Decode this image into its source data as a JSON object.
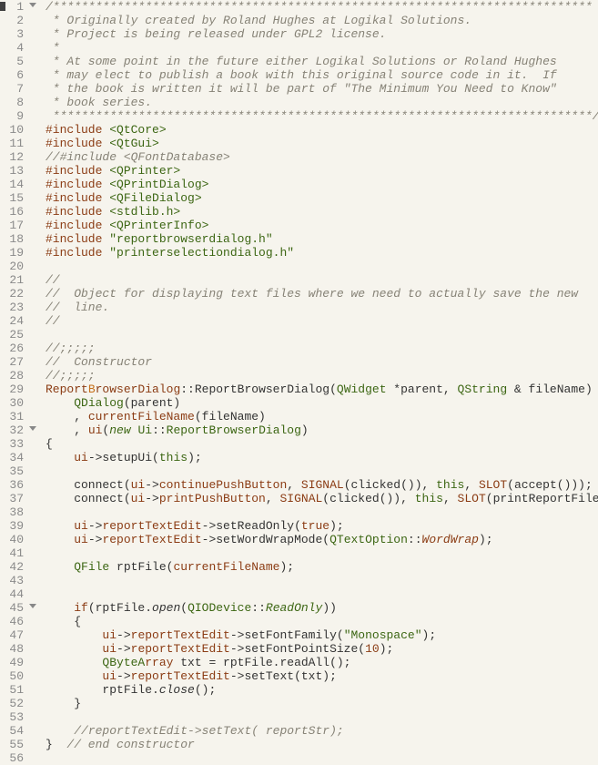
{
  "line_numbers": [
    "1",
    "2",
    "3",
    "4",
    "5",
    "6",
    "7",
    "8",
    "9",
    "10",
    "11",
    "12",
    "13",
    "14",
    "15",
    "16",
    "17",
    "18",
    "19",
    "20",
    "21",
    "22",
    "23",
    "24",
    "25",
    "26",
    "27",
    "28",
    "29",
    "30",
    "31",
    "32",
    "33",
    "34",
    "35",
    "36",
    "37",
    "38",
    "39",
    "40",
    "41",
    "42",
    "43",
    "44",
    "45",
    "46",
    "47",
    "48",
    "49",
    "50",
    "51",
    "52",
    "53",
    "54",
    "55",
    "56"
  ],
  "fold_lines": [
    1,
    32,
    45
  ],
  "marker_lines": [
    1
  ],
  "colors": {
    "background": "#f6f4ed",
    "gutter_text": "#8a8a8a",
    "comment": "#868276",
    "preprocessor": "#8b3c14",
    "include_bracket": "#3c6613",
    "string": "#3c6613",
    "keyword": "#8b3c14",
    "type": "#3c6613",
    "number": "#8b3c14",
    "field": "#8b3c14"
  },
  "code": [
    {
      "n": 1,
      "seg": [
        [
          "/****************************************************************************",
          "comment"
        ]
      ]
    },
    {
      "n": 2,
      "seg": [
        [
          " * Originally created by Roland Hughes at Logikal Solutions.",
          "comment"
        ]
      ]
    },
    {
      "n": 3,
      "seg": [
        [
          " * Project is being released under GPL2 license.",
          "comment"
        ]
      ]
    },
    {
      "n": 4,
      "seg": [
        [
          " *",
          "comment"
        ]
      ]
    },
    {
      "n": 5,
      "seg": [
        [
          " * At some point in the future either Logikal Solutions or Roland Hughes",
          "comment"
        ]
      ]
    },
    {
      "n": 6,
      "seg": [
        [
          " * may elect to publish a book with this original source code in it.  If",
          "comment"
        ]
      ]
    },
    {
      "n": 7,
      "seg": [
        [
          " * the book is written it will be part of \"The Minimum You Need to Know\"",
          "comment"
        ]
      ]
    },
    {
      "n": 8,
      "seg": [
        [
          " * book series.",
          "comment"
        ]
      ]
    },
    {
      "n": 9,
      "seg": [
        [
          " ****************************************************************************/",
          "comment"
        ]
      ]
    },
    {
      "n": 10,
      "seg": [
        [
          "#include ",
          "preproc"
        ],
        [
          "<QtCore>",
          "include"
        ]
      ]
    },
    {
      "n": 11,
      "seg": [
        [
          "#include ",
          "preproc"
        ],
        [
          "<QtGui>",
          "include"
        ]
      ]
    },
    {
      "n": 12,
      "seg": [
        [
          "//#include <QFontDatabase>",
          "comment"
        ]
      ]
    },
    {
      "n": 13,
      "seg": [
        [
          "#include ",
          "preproc"
        ],
        [
          "<QPrinter>",
          "include"
        ]
      ]
    },
    {
      "n": 14,
      "seg": [
        [
          "#include ",
          "preproc"
        ],
        [
          "<QPrintDialog>",
          "include"
        ]
      ]
    },
    {
      "n": 15,
      "seg": [
        [
          "#include ",
          "preproc"
        ],
        [
          "<QFileDialog>",
          "include"
        ]
      ]
    },
    {
      "n": 16,
      "seg": [
        [
          "#include ",
          "preproc"
        ],
        [
          "<stdlib.h>",
          "include"
        ]
      ]
    },
    {
      "n": 17,
      "seg": [
        [
          "#include ",
          "preproc"
        ],
        [
          "<QPrinterInfo>",
          "include"
        ]
      ]
    },
    {
      "n": 18,
      "seg": [
        [
          "#include ",
          "preproc"
        ],
        [
          "\"reportbrowserdialog.h\"",
          "string"
        ]
      ]
    },
    {
      "n": 19,
      "seg": [
        [
          "#include ",
          "preproc"
        ],
        [
          "\"printerselectiondialog.h\"",
          "string"
        ]
      ]
    },
    {
      "n": 20,
      "seg": [
        [
          "",
          ""
        ]
      ]
    },
    {
      "n": 21,
      "seg": [
        [
          "//",
          "comment"
        ]
      ]
    },
    {
      "n": 22,
      "seg": [
        [
          "//  Object for displaying text files where we need to actually save the new",
          "comment"
        ]
      ]
    },
    {
      "n": 23,
      "seg": [
        [
          "//  line.",
          "comment"
        ]
      ]
    },
    {
      "n": 24,
      "seg": [
        [
          "//",
          "comment"
        ]
      ]
    },
    {
      "n": 25,
      "seg": [
        [
          "",
          ""
        ]
      ]
    },
    {
      "n": 26,
      "seg": [
        [
          "//;;;;;",
          "comment"
        ]
      ]
    },
    {
      "n": 27,
      "seg": [
        [
          "//  Constructor",
          "comment"
        ]
      ]
    },
    {
      "n": 28,
      "seg": [
        [
          "//;;;;;",
          "comment"
        ]
      ]
    },
    {
      "n": 29,
      "seg": [
        [
          "Report",
          "cls"
        ],
        [
          "B",
          "reportcls"
        ],
        [
          "rowserDialog",
          "cls"
        ],
        [
          "::ReportBrowserDialog(",
          "op"
        ],
        [
          "QWidget",
          "type"
        ],
        [
          " *parent, ",
          "op"
        ],
        [
          "QString",
          "type"
        ],
        [
          " & fileName) :",
          "op"
        ]
      ]
    },
    {
      "n": 30,
      "seg": [
        [
          "    ",
          ""
        ],
        [
          "QDialog",
          "type"
        ],
        [
          "(parent)",
          "op"
        ]
      ]
    },
    {
      "n": 31,
      "seg": [
        [
          "    , ",
          ""
        ],
        [
          "currentFileName",
          "field"
        ],
        [
          "(fileName)",
          "op"
        ]
      ]
    },
    {
      "n": 32,
      "seg": [
        [
          "    , ",
          ""
        ],
        [
          "ui",
          "field"
        ],
        [
          "(",
          "op"
        ],
        [
          "new",
          "newfn"
        ],
        [
          " ",
          ""
        ],
        [
          "Ui",
          "type"
        ],
        [
          "::",
          "op"
        ],
        [
          "ReportBrowserDialog",
          "type"
        ],
        [
          ")",
          "op"
        ]
      ]
    },
    {
      "n": 33,
      "seg": [
        [
          "{",
          "op"
        ]
      ]
    },
    {
      "n": 34,
      "seg": [
        [
          "    ",
          ""
        ],
        [
          "ui",
          "field"
        ],
        [
          "->setupUi(",
          "op"
        ],
        [
          "this",
          "this"
        ],
        [
          ");",
          "op"
        ]
      ]
    },
    {
      "n": 35,
      "seg": [
        [
          "",
          ""
        ]
      ]
    },
    {
      "n": 36,
      "seg": [
        [
          "    connect(",
          ""
        ],
        [
          "ui",
          "field"
        ],
        [
          "->",
          "op"
        ],
        [
          "continuePushButton",
          "field"
        ],
        [
          ", ",
          "op"
        ],
        [
          "SIGNAL",
          "sigslot"
        ],
        [
          "(clicked()), ",
          "op"
        ],
        [
          "this",
          "this"
        ],
        [
          ", ",
          "op"
        ],
        [
          "SLOT",
          "sigslot"
        ],
        [
          "(accept()));",
          "op"
        ]
      ]
    },
    {
      "n": 37,
      "seg": [
        [
          "    connect(",
          ""
        ],
        [
          "ui",
          "field"
        ],
        [
          "->",
          "op"
        ],
        [
          "printPushButton",
          "field"
        ],
        [
          ", ",
          "op"
        ],
        [
          "SIGNAL",
          "sigslot"
        ],
        [
          "(clicked()), ",
          "op"
        ],
        [
          "this",
          "this"
        ],
        [
          ", ",
          "op"
        ],
        [
          "SLOT",
          "sigslot"
        ],
        [
          "(printReportFile()));",
          "op"
        ]
      ]
    },
    {
      "n": 38,
      "seg": [
        [
          "",
          ""
        ]
      ]
    },
    {
      "n": 39,
      "seg": [
        [
          "    ",
          ""
        ],
        [
          "ui",
          "field"
        ],
        [
          "->",
          "op"
        ],
        [
          "reportTextEdit",
          "field"
        ],
        [
          "->setReadOnly(",
          "op"
        ],
        [
          "true",
          "bool"
        ],
        [
          ");",
          "op"
        ]
      ]
    },
    {
      "n": 40,
      "seg": [
        [
          "    ",
          ""
        ],
        [
          "ui",
          "field"
        ],
        [
          "->",
          "op"
        ],
        [
          "reportTextEdit",
          "field"
        ],
        [
          "->setWordWrapMode(",
          "op"
        ],
        [
          "QTextOption",
          "type"
        ],
        [
          "::",
          "op"
        ],
        [
          "WordWrap",
          "wordwrap"
        ],
        [
          ");",
          "op"
        ]
      ]
    },
    {
      "n": 41,
      "seg": [
        [
          "",
          ""
        ]
      ]
    },
    {
      "n": 42,
      "seg": [
        [
          "    ",
          ""
        ],
        [
          "QFile",
          "type"
        ],
        [
          " rptFile(",
          "op"
        ],
        [
          "currentFileName",
          "field"
        ],
        [
          ");",
          "op"
        ]
      ]
    },
    {
      "n": 43,
      "seg": [
        [
          "",
          ""
        ]
      ]
    },
    {
      "n": 44,
      "seg": [
        [
          "",
          ""
        ]
      ]
    },
    {
      "n": 45,
      "seg": [
        [
          "    ",
          ""
        ],
        [
          "if",
          "keyword"
        ],
        [
          "(rptFile.",
          "op"
        ],
        [
          "open",
          "italic"
        ],
        [
          "(",
          "op"
        ],
        [
          "QIODevice",
          "type"
        ],
        [
          "::",
          "op"
        ],
        [
          "ReadOnly",
          "readonly"
        ],
        [
          "))",
          "op"
        ]
      ]
    },
    {
      "n": 46,
      "seg": [
        [
          "    {",
          "op"
        ]
      ]
    },
    {
      "n": 47,
      "seg": [
        [
          "        ",
          ""
        ],
        [
          "ui",
          "field"
        ],
        [
          "->",
          "op"
        ],
        [
          "reportTextEdit",
          "field"
        ],
        [
          "->setFontFamily(",
          "op"
        ],
        [
          "\"Monospace\"",
          "string"
        ],
        [
          ");",
          "op"
        ]
      ]
    },
    {
      "n": 48,
      "seg": [
        [
          "        ",
          ""
        ],
        [
          "ui",
          "field"
        ],
        [
          "->",
          "op"
        ],
        [
          "reportTextEdit",
          "field"
        ],
        [
          "->setFontPointSize(",
          "op"
        ],
        [
          "10",
          "number"
        ],
        [
          ");",
          "op"
        ]
      ]
    },
    {
      "n": 49,
      "seg": [
        [
          "        ",
          ""
        ],
        [
          "QByteA",
          "type"
        ],
        [
          "rray",
          "cls"
        ],
        [
          " txt = rptFile.readAll();",
          "op"
        ]
      ]
    },
    {
      "n": 50,
      "seg": [
        [
          "        ",
          ""
        ],
        [
          "ui",
          "field"
        ],
        [
          "->",
          "op"
        ],
        [
          "reportTextEdit",
          "field"
        ],
        [
          "->setText(txt);",
          "op"
        ]
      ]
    },
    {
      "n": 51,
      "seg": [
        [
          "        rptFile.",
          ""
        ],
        [
          "close",
          "italic"
        ],
        [
          "();",
          "op"
        ]
      ]
    },
    {
      "n": 52,
      "seg": [
        [
          "    }",
          "op"
        ]
      ]
    },
    {
      "n": 53,
      "seg": [
        [
          "",
          ""
        ]
      ]
    },
    {
      "n": 54,
      "seg": [
        [
          "    ",
          ""
        ],
        [
          "//reportTextEdit->setText( reportStr);",
          "comment"
        ]
      ]
    },
    {
      "n": 55,
      "seg": [
        [
          "}  ",
          "op"
        ],
        [
          "// end constructor",
          "comment"
        ]
      ]
    },
    {
      "n": 56,
      "seg": [
        [
          "",
          ""
        ]
      ]
    }
  ]
}
